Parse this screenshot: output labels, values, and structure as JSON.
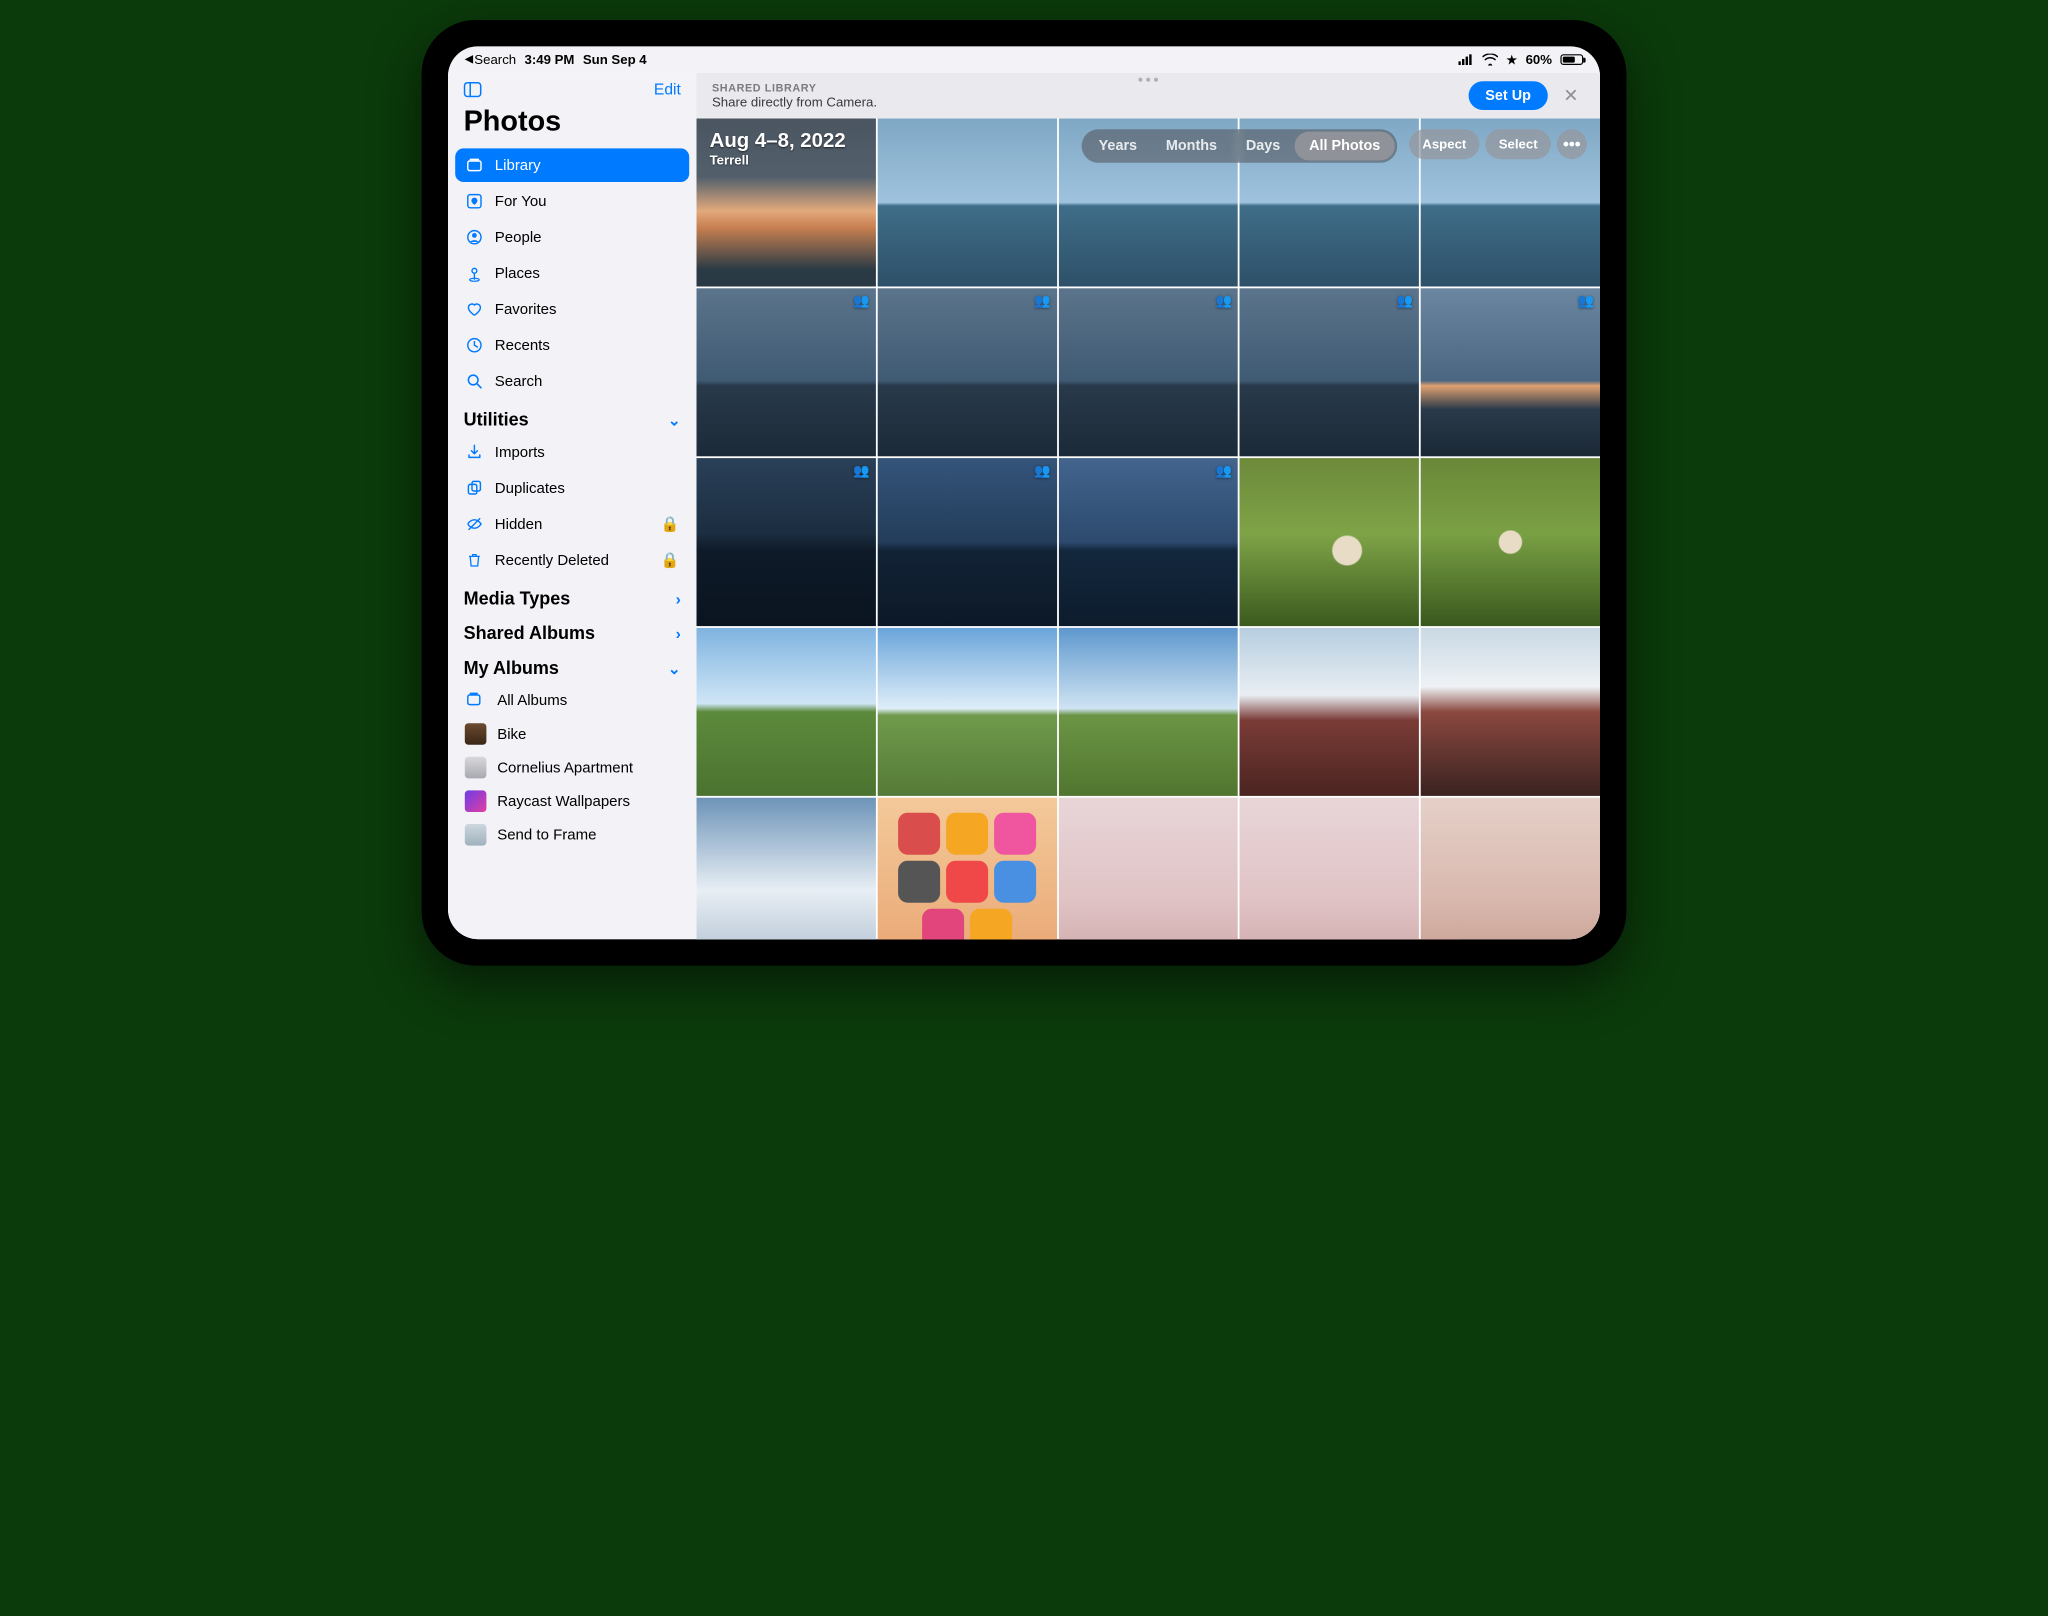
{
  "statusbar": {
    "back_label": "Search",
    "time": "3:49 PM",
    "date": "Sun Sep 4",
    "battery_pct": "60%"
  },
  "sidebar": {
    "edit": "Edit",
    "title": "Photos",
    "nav": [
      {
        "id": "library",
        "label": "Library",
        "selected": true
      },
      {
        "id": "for-you",
        "label": "For You"
      },
      {
        "id": "people",
        "label": "People"
      },
      {
        "id": "places",
        "label": "Places"
      },
      {
        "id": "favorites",
        "label": "Favorites"
      },
      {
        "id": "recents",
        "label": "Recents"
      },
      {
        "id": "search",
        "label": "Search"
      }
    ],
    "sections": {
      "utilities": "Utilities",
      "media_types": "Media Types",
      "shared_albums": "Shared Albums",
      "my_albums": "My Albums"
    },
    "utilities": [
      {
        "id": "imports",
        "label": "Imports"
      },
      {
        "id": "duplicates",
        "label": "Duplicates"
      },
      {
        "id": "hidden",
        "label": "Hidden",
        "locked": true
      },
      {
        "id": "recently-deleted",
        "label": "Recently Deleted",
        "locked": true
      }
    ],
    "my_albums": [
      {
        "id": "all-albums",
        "label": "All Albums"
      },
      {
        "id": "bike",
        "label": "Bike"
      },
      {
        "id": "cornelius",
        "label": "Cornelius Apartment"
      },
      {
        "id": "raycast",
        "label": "Raycast Wallpapers"
      },
      {
        "id": "send-to-frame",
        "label": "Send to Frame"
      }
    ]
  },
  "banner": {
    "title": "SHARED LIBRARY",
    "subtitle": "Share directly from Camera.",
    "setup": "Set Up"
  },
  "header": {
    "date_range": "Aug 4–8, 2022",
    "location": "Terrell",
    "segments": [
      "Years",
      "Months",
      "Days",
      "All Photos"
    ],
    "selected_segment": 3,
    "aspect": "Aspect",
    "select": "Select"
  },
  "grid": {
    "rows": [
      [
        {
          "cls": "sunset"
        },
        {
          "cls": "lake"
        },
        {
          "cls": "lake"
        },
        {
          "cls": "lake"
        },
        {
          "cls": "lake"
        }
      ],
      [
        {
          "cls": "stormy",
          "shared": true
        },
        {
          "cls": "stormy",
          "shared": true
        },
        {
          "cls": "stormy",
          "shared": true
        },
        {
          "cls": "stormy",
          "shared": true
        },
        {
          "cls": "stormy2",
          "shared": true
        }
      ],
      [
        {
          "cls": "dusk",
          "shared": true
        },
        {
          "cls": "dusk2",
          "shared": true
        },
        {
          "cls": "dusk3",
          "shared": true
        },
        {
          "cls": "grass"
        },
        {
          "cls": "grass2"
        }
      ],
      [
        {
          "cls": "park"
        },
        {
          "cls": "park2"
        },
        {
          "cls": "park3"
        },
        {
          "cls": "bridge"
        },
        {
          "cls": "bridge2"
        }
      ],
      [
        {
          "cls": "clouds"
        },
        {
          "cls": "home"
        },
        {
          "cls": "pastel"
        },
        {
          "cls": "pastel"
        },
        {
          "cls": "pastel2"
        }
      ]
    ]
  }
}
